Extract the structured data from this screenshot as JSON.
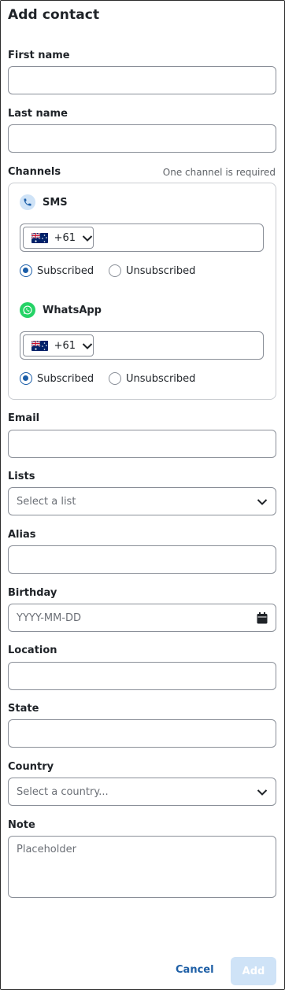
{
  "dialog": {
    "title": "Add contact"
  },
  "fields": {
    "first_name": {
      "label": "First name",
      "value": ""
    },
    "last_name": {
      "label": "Last name",
      "value": ""
    },
    "email": {
      "label": "Email",
      "value": ""
    },
    "lists": {
      "label": "Lists",
      "placeholder": "Select a list"
    },
    "alias": {
      "label": "Alias",
      "value": ""
    },
    "birthday": {
      "label": "Birthday",
      "placeholder": "YYYY-MM-DD"
    },
    "location": {
      "label": "Location",
      "value": ""
    },
    "state": {
      "label": "State",
      "value": ""
    },
    "country": {
      "label": "Country",
      "placeholder": "Select a country..."
    },
    "note": {
      "label": "Note",
      "placeholder": "Placeholder"
    }
  },
  "channels": {
    "label": "Channels",
    "hint": "One channel is required",
    "items": [
      {
        "name": "SMS",
        "icon": "phone-icon",
        "icon_bg": "#cfe3f7",
        "country_code": "+61",
        "flag": "australia-flag",
        "options": [
          "Subscribed",
          "Unsubscribed"
        ],
        "selected": "Subscribed"
      },
      {
        "name": "WhatsApp",
        "icon": "whatsapp-icon",
        "icon_bg": "#25d366",
        "country_code": "+61",
        "flag": "australia-flag",
        "options": [
          "Subscribed",
          "Unsubscribed"
        ],
        "selected": "Subscribed"
      }
    ]
  },
  "footer": {
    "cancel_label": "Cancel",
    "add_label": "Add"
  },
  "colors": {
    "accent": "#1a5da8",
    "link": "#1e5fa6",
    "disabled_button": "#cfe3f7"
  }
}
